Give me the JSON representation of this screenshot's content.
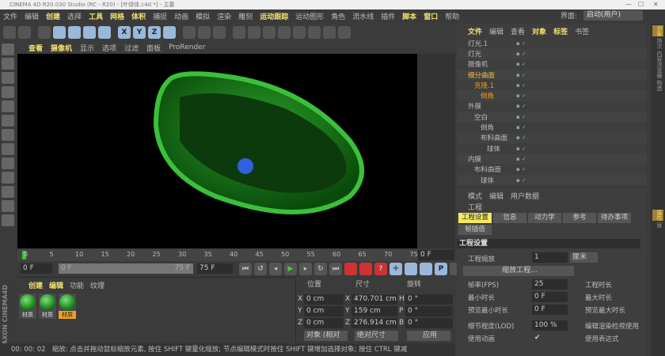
{
  "window": {
    "title": "CINEMA 4D R20.030 Studio (RC - R20) - [叶绿体.c4d *] - 主要"
  },
  "menubar": {
    "items": [
      "文件",
      "编辑",
      "创建",
      "选择",
      "工具",
      "网格",
      "体积",
      "捕捉",
      "动画",
      "模拟",
      "渲染",
      "雕刻",
      "运动跟踪",
      "运动图形",
      "角色",
      "流水线",
      "插件",
      "脚本",
      "窗口",
      "帮助"
    ],
    "highlighted": [
      2,
      4,
      5,
      6,
      12,
      17,
      18
    ],
    "layout_label": "界面:",
    "layout_value": "启动(用户)"
  },
  "toolbar": {
    "icons": [
      "undo-icon",
      "redo-icon",
      "live-select-icon",
      "move-icon",
      "scale-icon",
      "rotate-icon",
      "last-tool-icon",
      "x-axis-icon",
      "y-axis-icon",
      "z-axis-icon",
      "coordinate-system-icon",
      "render-view-icon",
      "render-picture-viewer-icon",
      "render-settings-icon",
      "cube-icon",
      "pen-icon",
      "subdivision-icon",
      "array-icon",
      "deformer-icon",
      "floor-icon",
      "camera-icon",
      "light-icon"
    ],
    "axis_labels": [
      "X",
      "Y",
      "Z"
    ]
  },
  "viewport": {
    "menu": [
      "查看",
      "摄像机",
      "显示",
      "选项",
      "过滤",
      "面板",
      "ProRender"
    ]
  },
  "timeline": {
    "ticks": [
      "0",
      "5",
      "10",
      "15",
      "20",
      "25",
      "30",
      "35",
      "40",
      "45",
      "50",
      "55",
      "60",
      "65",
      "70",
      "75"
    ],
    "current_frame": "0 F",
    "start": "0 F",
    "range_start": "0 F",
    "range_end": "75 F",
    "end": "75 F"
  },
  "materials": {
    "menu": [
      "创建",
      "编辑",
      "功能",
      "纹理"
    ],
    "items": [
      {
        "label": "材质"
      },
      {
        "label": "材质"
      },
      {
        "label": "材质",
        "selected": true
      }
    ]
  },
  "coordinates": {
    "headers": [
      "位置",
      "尺寸",
      "旋转"
    ],
    "rows": [
      {
        "axis": "X",
        "pos": "0 cm",
        "size": "470.701 cm",
        "raxis": "H",
        "rot": "0 °"
      },
      {
        "axis": "Y",
        "pos": "0 cm",
        "size": "159 cm",
        "raxis": "P",
        "rot": "0 °"
      },
      {
        "axis": "Z",
        "pos": "0 cm",
        "size": "276.914 cm",
        "raxis": "B",
        "rot": "0 °"
      }
    ],
    "mode": "对象 (相对",
    "size_mode": "绝对尺寸",
    "apply": "应用"
  },
  "status": {
    "time": "00: 00: 02",
    "message": "缩放: 点击并拖动鼠标缩放元素, 按住 SHIFT 键量化缩放; 节点编辑模式时按住 SHIFT 键增加选择对象; 按住 CTRL 键减"
  },
  "object_manager": {
    "menu": [
      "文件",
      "编辑",
      "查看",
      "对象",
      "标签",
      "书签"
    ],
    "objects": [
      {
        "name": "灯光.1",
        "indent": 0,
        "color": "#bbbbbb"
      },
      {
        "name": "灯光",
        "indent": 0,
        "color": "#bbbbbb"
      },
      {
        "name": "摄像机",
        "indent": 0,
        "color": "#bbbbbb"
      },
      {
        "name": "细分曲面",
        "indent": 0,
        "color": "#f0c040"
      },
      {
        "name": "克隆.1",
        "indent": 1,
        "color": "#e0a020"
      },
      {
        "name": "倒角",
        "indent": 2,
        "color": "#e0a020"
      },
      {
        "name": "外膜",
        "indent": 0,
        "color": "#bbbbbb"
      },
      {
        "name": "空白",
        "indent": 1,
        "color": "#bbbbbb"
      },
      {
        "name": "倒角",
        "indent": 2,
        "color": "#bbbbbb"
      },
      {
        "name": "布料曲面",
        "indent": 2,
        "color": "#bbbbbb"
      },
      {
        "name": "球体",
        "indent": 3,
        "color": "#bbbbbb"
      },
      {
        "name": "内膜",
        "indent": 0,
        "color": "#bbbbbb"
      },
      {
        "name": "布料曲面",
        "indent": 1,
        "color": "#bbbbbb"
      },
      {
        "name": "球体",
        "indent": 2,
        "color": "#bbbbbb"
      }
    ]
  },
  "attributes": {
    "menu": [
      "模式",
      "编辑",
      "用户数据"
    ],
    "object": "工程",
    "tabs": [
      "工程设置",
      "信息",
      "动力学",
      "参考",
      "待办事项",
      "帧插值"
    ],
    "section": "工程设置",
    "scale_label": "工程缩放",
    "scale_value": "1",
    "scale_unit": "厘米",
    "scale_button": "缩放工程...",
    "rows": [
      {
        "label": "帧率(FPS)",
        "value": "25",
        "right": "工程时长"
      },
      {
        "label": "最小时长",
        "value": "0 F",
        "right": "最大时长"
      },
      {
        "label": "预览最小时长",
        "value": "0 F",
        "right": "预览最大时长"
      },
      {
        "label": "细节程度(LOD)",
        "value": "100 %",
        "right": "编辑渲染检视使用"
      },
      {
        "label": "使用动画",
        "value": "✔",
        "right": "使用表达式"
      }
    ]
  },
  "right_tabs": [
    "对象",
    "场次",
    "内容浏览器",
    "构造",
    "属性",
    "层"
  ],
  "colors": {
    "accent": "#f0e070",
    "selected_tab": "#f8e860",
    "material_selected": "#f0a020"
  }
}
